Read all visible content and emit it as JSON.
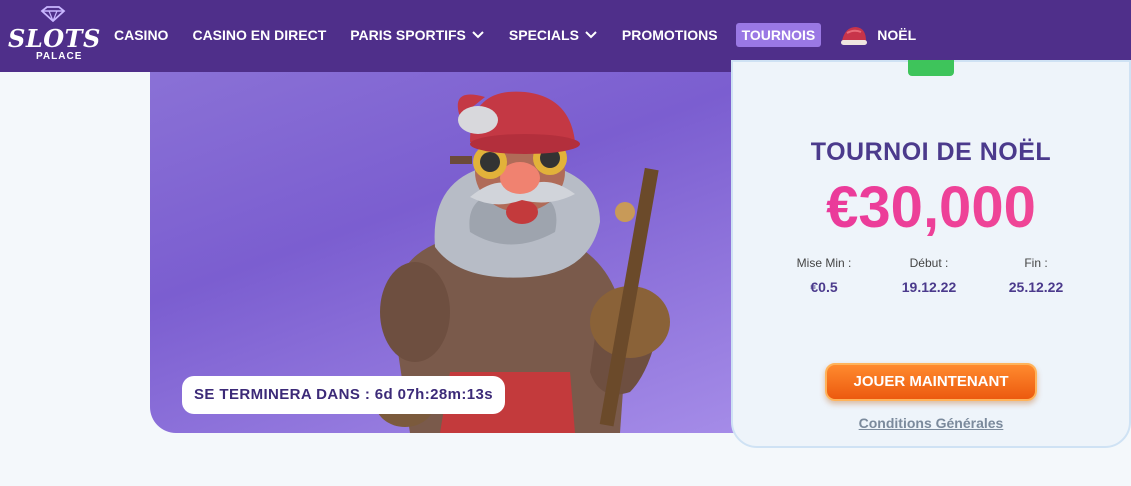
{
  "brand": {
    "logo_word": "SLOTS",
    "logo_sub": "PALACE"
  },
  "nav": {
    "items": [
      {
        "label": "CASINO"
      },
      {
        "label": "CASINO EN DIRECT"
      },
      {
        "label": "PARIS SPORTIFS",
        "dropdown": true
      },
      {
        "label": "SPECIALS",
        "dropdown": true
      },
      {
        "label": "PROMOTIONS"
      },
      {
        "label": "TOURNOIS",
        "active": true
      },
      {
        "label": "NOËL",
        "icon": "santa-hat-icon"
      }
    ]
  },
  "hero": {
    "countdown": "SE TERMINERA DANS : 6d 07h:28m:13s"
  },
  "tournament": {
    "title": "TOURNOI DE NOËL",
    "prize": "€30,000",
    "min_bet_label": "Mise Min :",
    "min_bet_value": "€0.5",
    "start_label": "Début :",
    "start_value": "19.12.22",
    "end_label": "Fin :",
    "end_value": "25.12.22",
    "play_button": "JOUER MAINTENANT",
    "terms_link": "Conditions Générales"
  },
  "colors": {
    "nav_bg": "#4f2f8a",
    "active_tab": "#9a78e4",
    "prize_pink": "#ef3e9c",
    "play_orange": "#f2701e",
    "title_purple": "#4b3a8c"
  }
}
